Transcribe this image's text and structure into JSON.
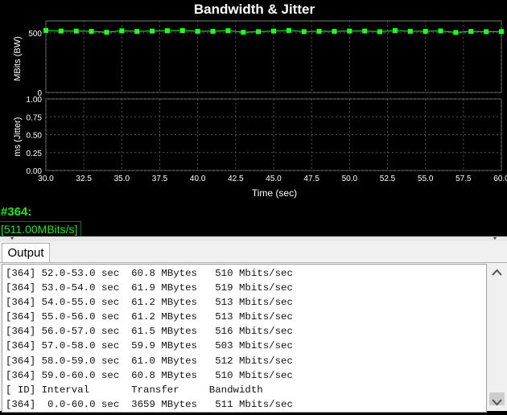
{
  "graph": {
    "title": "Bandwidth & Jitter",
    "xlabel": "Time (sec)",
    "colors": {
      "background": "#000000",
      "series": "#22ff22",
      "grid": "#555555",
      "axis_text": "#ffffff"
    }
  },
  "chart_data": [
    {
      "type": "line",
      "title": "Bandwidth & Jitter",
      "ylabel": "MBits (BW)",
      "xlabel": "",
      "xlim": [
        30.0,
        60.0
      ],
      "ylim": [
        0,
        600
      ],
      "yticks": [
        "0",
        "500"
      ],
      "grid": true,
      "series": [
        {
          "x": [
            30.0,
            31.0,
            32.0,
            33.0,
            34.0,
            35.0,
            36.0,
            37.0,
            38.0,
            39.0,
            40.0,
            41.0,
            42.0,
            43.0,
            44.0,
            45.0,
            46.0,
            47.0,
            48.0,
            49.0,
            50.0,
            51.0,
            52.0,
            53.0,
            54.0,
            55.0,
            56.0,
            57.0,
            58.0,
            59.0,
            60.0
          ],
          "values": [
            520,
            515,
            515,
            512,
            505,
            517,
            512,
            515,
            518,
            519,
            513,
            513,
            518,
            505,
            510,
            515,
            520,
            510,
            513,
            512,
            515,
            515,
            510,
            519,
            513,
            513,
            516,
            503,
            512,
            510,
            511
          ]
        }
      ]
    },
    {
      "type": "line",
      "title": "",
      "ylabel": "ms (Jitter)",
      "xlabel": "Time (sec)",
      "xlim": [
        30.0,
        60.0
      ],
      "ylim": [
        0,
        1
      ],
      "yticks": [
        "0.00",
        "0.25",
        "0.50",
        "0.75",
        "1.00"
      ],
      "xticks": [
        "30.0",
        "32.5",
        "35.0",
        "37.5",
        "40.0",
        "42.5",
        "45.0",
        "47.5",
        "50.0",
        "52.5",
        "55.0",
        "57.5",
        "60.0"
      ],
      "grid": true,
      "series": []
    }
  ],
  "stream": {
    "id": "#364:",
    "rate": "[511.00MBits/s]"
  },
  "output": {
    "tab_label": "Output",
    "lines": [
      "[364] 52.0-53.0 sec  60.8 MBytes   510 Mbits/sec",
      "[364] 53.0-54.0 sec  61.9 MBytes   519 Mbits/sec",
      "[364] 54.0-55.0 sec  61.2 MBytes   513 Mbits/sec",
      "[364] 55.0-56.0 sec  61.2 MBytes   513 Mbits/sec",
      "[364] 56.0-57.0 sec  61.5 MBytes   516 Mbits/sec",
      "[364] 57.0-58.0 sec  59.9 MBytes   503 Mbits/sec",
      "[364] 58.0-59.0 sec  61.0 MBytes   512 Mbits/sec",
      "[364] 59.0-60.0 sec  60.8 MBytes   510 Mbits/sec",
      "[ ID] Interval       Transfer     Bandwidth",
      "[364]  0.0-60.0 sec  3659 MBytes   511 Mbits/sec"
    ]
  },
  "icons": {
    "scroll_up": "chevron-up-icon",
    "scroll_down": "chevron-down-icon",
    "splitter": "splitter-grip-icon"
  }
}
